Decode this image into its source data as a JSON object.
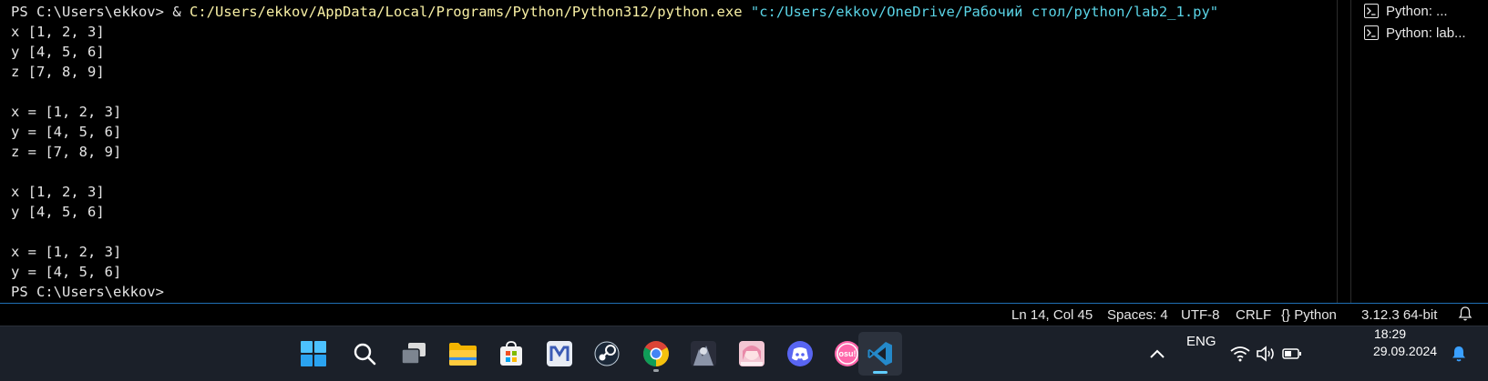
{
  "terminal": {
    "lines": [
      {
        "prompt": "PS C:\\Users\\ekkov> ",
        "amp": "& ",
        "exe": "C:/Users/ekkov/AppData/Local/Programs/Python/Python312/python.exe",
        "arg": " \"c:/Users/ekkov/OneDrive/Рабочий стол/python/lab2_1.py\""
      },
      {
        "text": "x [1, 2, 3]"
      },
      {
        "text": "y [4, 5, 6]"
      },
      {
        "text": "z [7, 8, 9]"
      },
      {
        "text": ""
      },
      {
        "text": "x = [1, 2, 3]"
      },
      {
        "text": "y = [4, 5, 6]"
      },
      {
        "text": "z = [7, 8, 9]"
      },
      {
        "text": ""
      },
      {
        "text": "x [1, 2, 3]"
      },
      {
        "text": "y [4, 5, 6]"
      },
      {
        "text": ""
      },
      {
        "text": "x = [1, 2, 3]"
      },
      {
        "text": "y = [4, 5, 6]"
      },
      {
        "text": "PS C:\\Users\\ekkov>"
      }
    ]
  },
  "terminal_tabs": [
    {
      "label": "Python: ...",
      "icon": "terminal-icon"
    },
    {
      "label": "Python: lab...",
      "icon": "terminal-icon"
    }
  ],
  "statusbar": {
    "position": "Ln 14, Col 45",
    "spaces": "Spaces: 4",
    "encoding": "UTF-8",
    "eol": "CRLF",
    "braces": "{}",
    "language": "Python",
    "interpreter": "3.12.3 64-bit",
    "bell_icon": "bell-icon",
    "accent_color": "#1f6fb5"
  },
  "taskbar": {
    "apps": [
      {
        "name": "start",
        "icon": "windows-start-icon"
      },
      {
        "name": "search",
        "icon": "search-icon"
      },
      {
        "name": "task-view",
        "icon": "task-view-icon"
      },
      {
        "name": "file-explorer",
        "icon": "folder-icon"
      },
      {
        "name": "microsoft-store",
        "icon": "store-icon"
      },
      {
        "name": "app-m",
        "icon": "m-app-icon"
      },
      {
        "name": "steam",
        "icon": "steam-icon"
      },
      {
        "name": "chrome",
        "icon": "chrome-icon"
      },
      {
        "name": "game-1",
        "icon": "game-thumbnail-icon"
      },
      {
        "name": "game-2",
        "icon": "anime-thumbnail-icon"
      },
      {
        "name": "discord",
        "icon": "discord-icon"
      },
      {
        "name": "osu",
        "icon": "osu-icon",
        "label": "osu!"
      },
      {
        "name": "vscode",
        "icon": "vscode-icon"
      }
    ],
    "tray": {
      "chevron": "chevron-up-icon",
      "language": "ENG",
      "time": "18:29",
      "date": "29.09.2024"
    }
  }
}
